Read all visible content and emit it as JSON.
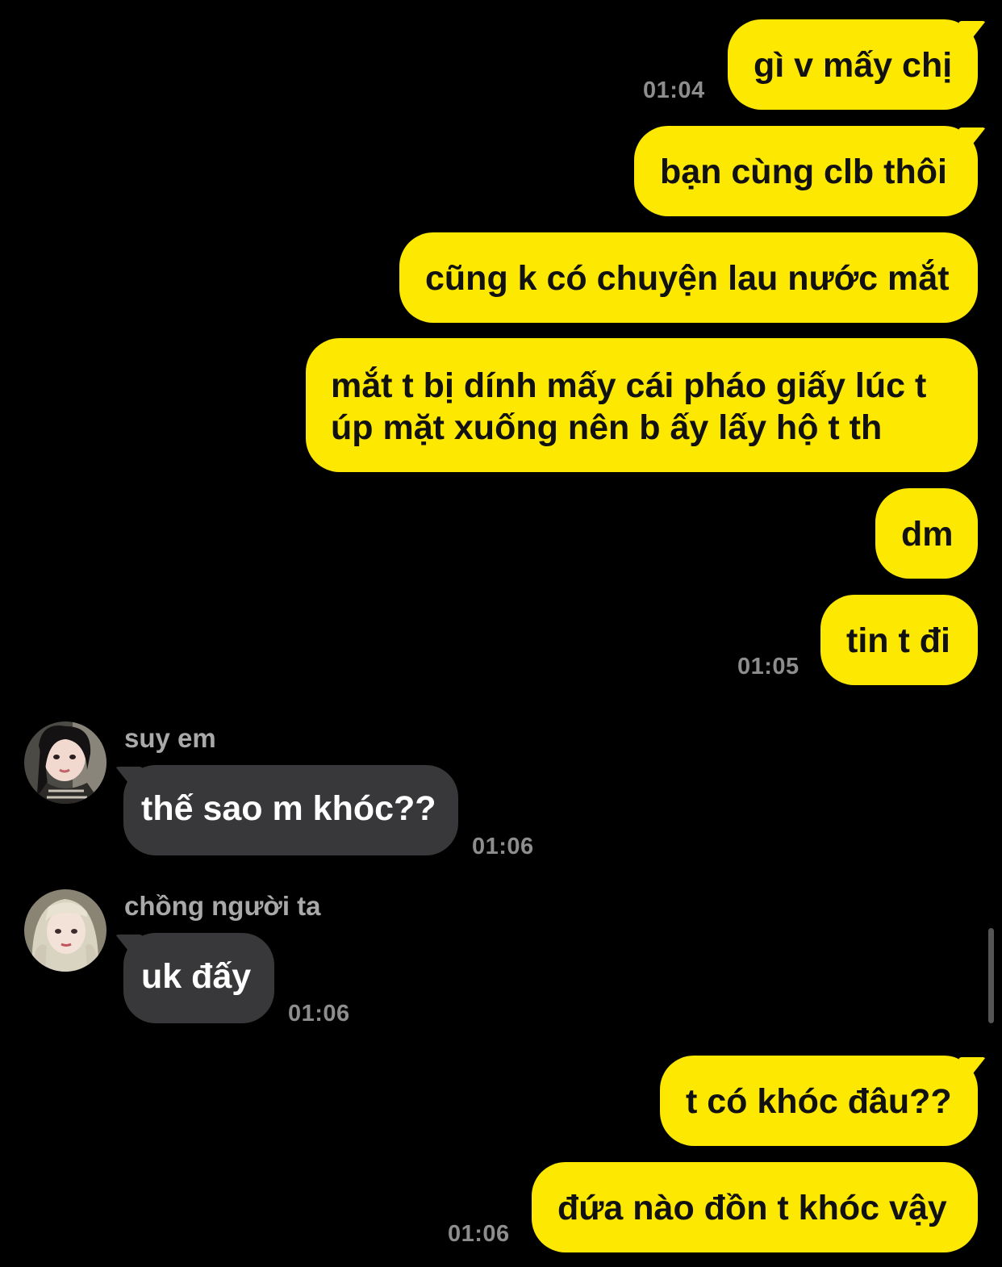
{
  "messages": {
    "m1": {
      "text": "gì v mấy chị",
      "time": "01:04"
    },
    "m2": {
      "text": "bạn cùng clb thôi"
    },
    "m3": {
      "text": "cũng k có chuyện lau nước mắt"
    },
    "m4": {
      "text": "mắt t bị dính mấy cái pháo giấy lúc t úp mặt xuống nên b ấy lấy hộ t th"
    },
    "m5": {
      "text": "dm"
    },
    "m6": {
      "text": "tin t đi",
      "time": "01:05"
    },
    "m7": {
      "sender": "suy em",
      "text": "thế sao m khóc??",
      "time": "01:06"
    },
    "m8": {
      "sender": "chồng người ta",
      "text": "uk đấy",
      "time": "01:06"
    },
    "m9": {
      "text": "t có khóc đâu??"
    },
    "m10": {
      "text": "đứa nào đồn t khóc vậy",
      "time": "01:06"
    }
  },
  "colors": {
    "background": "#000000",
    "outgoing_bubble": "#fde802",
    "incoming_bubble": "#38383a",
    "timestamp": "#8d8d8d",
    "sender_name": "#a9a9a9"
  },
  "icons": {
    "avatar_1": "profile-photo",
    "avatar_2": "profile-photo"
  }
}
